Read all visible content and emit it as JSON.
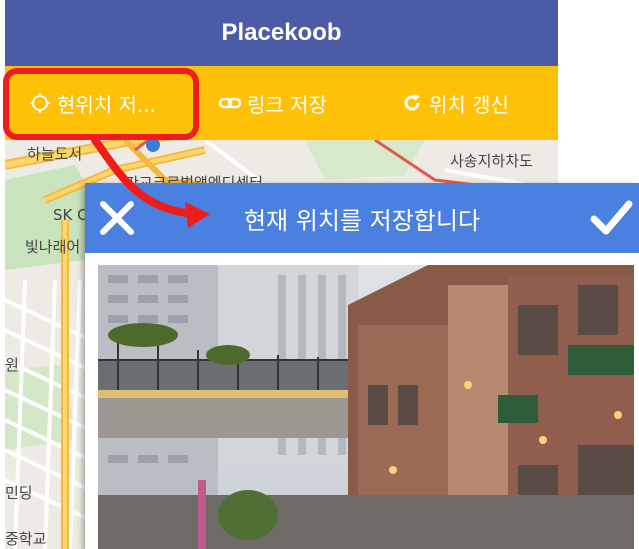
{
  "app": {
    "title": "Placekoob"
  },
  "toolbar": {
    "items": [
      {
        "label": "현위치 저...",
        "icon": "target-icon"
      },
      {
        "label": "링크 저장",
        "icon": "link-icon"
      },
      {
        "label": "위치 갱신",
        "icon": "refresh-icon"
      }
    ]
  },
  "map": {
    "labels": [
      "하늘도서",
      "사송지하차도",
      "판교크로벌앱엔디센터",
      "SK C",
      "빛나래어",
      "원",
      "민딩",
      "중학교"
    ]
  },
  "dialog": {
    "title": "현재 위치를 저장합니다",
    "close_icon": "close-icon",
    "confirm_icon": "check-icon"
  },
  "colors": {
    "appbar": "#4c5ba5",
    "toolbar": "#ffc107",
    "dialog_header": "#4a80e0",
    "highlight": "#f01c1c"
  }
}
